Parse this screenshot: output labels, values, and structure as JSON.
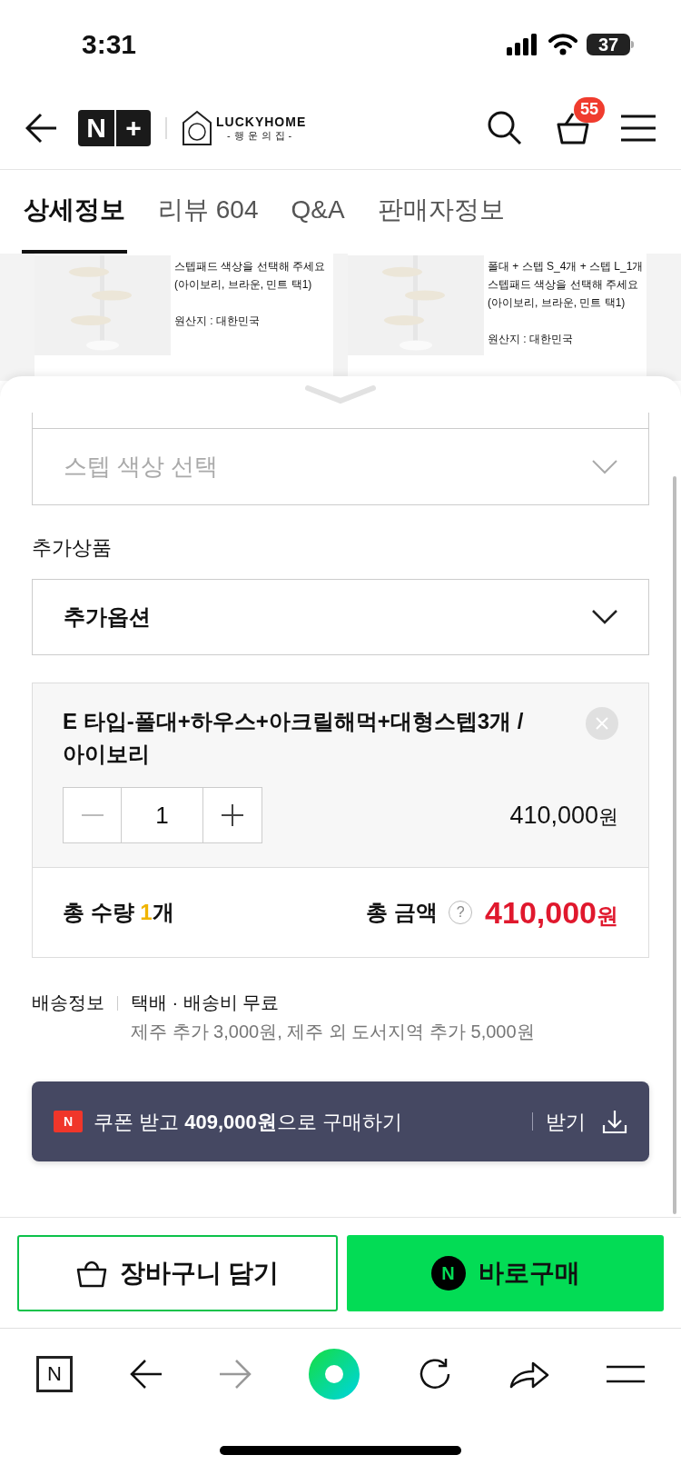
{
  "status_bar": {
    "time": "3:31",
    "battery": "37"
  },
  "header": {
    "brand_badge": [
      "N",
      "+"
    ],
    "store_logo": {
      "name": "LUCKYHOME",
      "subtitle": "-행운의집-"
    },
    "cart_count": "55"
  },
  "tabs": [
    {
      "label": "상세정보",
      "selected": true
    },
    {
      "label": "리뷰 604",
      "selected": false
    },
    {
      "label": "Q&A",
      "selected": false
    },
    {
      "label": "판매자정보",
      "selected": false
    }
  ],
  "detail_cards": [
    {
      "kind": "picture",
      "blocks": [
        [
          "스텝패드 색상을 선택해 주세요",
          "(아이보리, 브라운, 민트 택1)"
        ],
        [
          "원산지 : 대한민국"
        ]
      ]
    },
    {
      "kind": "picture",
      "blocks": [
        [
          "폴대 + 스텝 S_4개 + 스텝 L_1개",
          "스텝패드 색상을 선택해 주세요",
          "(아이보리, 브라운, 민트 택1)"
        ],
        [
          "원산지 : 대한민국"
        ]
      ]
    }
  ],
  "option_select": {
    "placeholder": "스텝 색상 선택"
  },
  "addon": {
    "label": "추가상품",
    "select_value": "추가옵션"
  },
  "selected_item": {
    "name": "E 타입-폴대+하우스+아크릴해먹+대형스텝3개 / 아이보리",
    "quantity": "1",
    "price": "410,000",
    "price_unit": "원"
  },
  "total": {
    "quantity_label": "총 수량",
    "quantity_value": "1",
    "quantity_unit": "개",
    "amount_label": "총 금액",
    "help": "?",
    "amount": "410,000",
    "amount_unit": "원"
  },
  "shipping": {
    "label": "배송정보",
    "method": "택배 · 배송비 무료",
    "note": "제주 추가 3,000원, 제주 외 도서지역 추가 5,000원"
  },
  "coupon": {
    "badge": "N",
    "text": "쿠폰 받고 **409,000원**으로 구매하기",
    "action": "받기"
  },
  "buttons": {
    "cart": "장바구니 담기",
    "buy_badge": "N",
    "buy": "바로구매"
  },
  "browser_bar": {
    "home": "N"
  }
}
